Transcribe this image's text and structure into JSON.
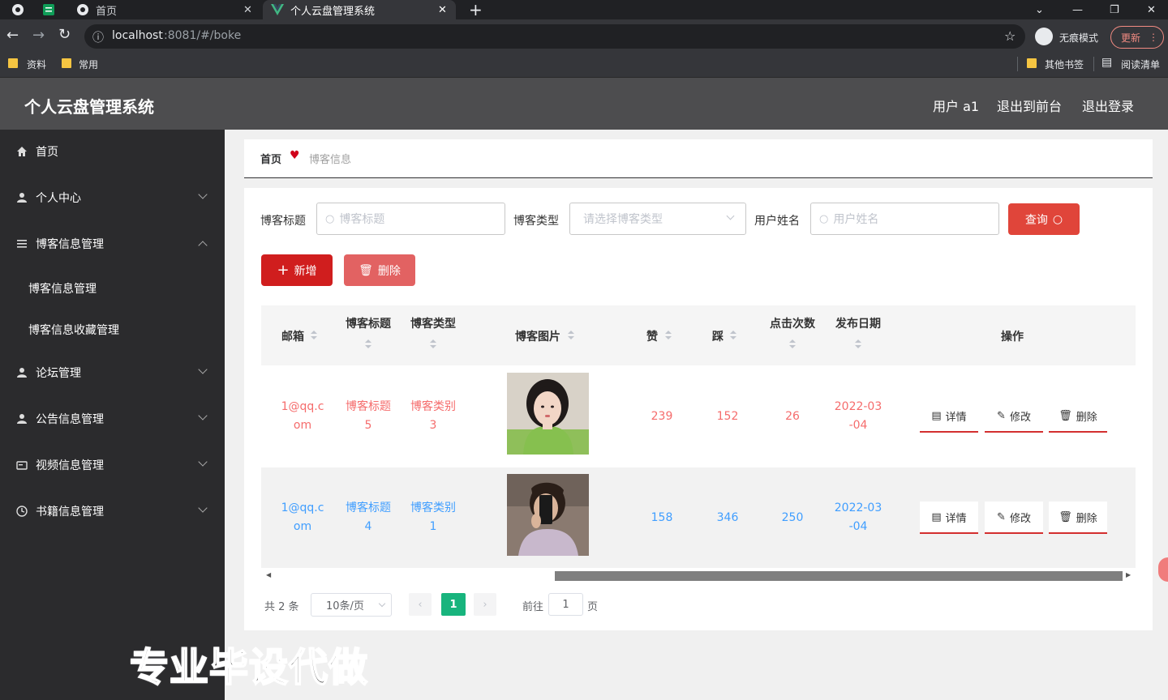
{
  "browser": {
    "tabs": [
      {
        "title": "首页"
      },
      {
        "title": "个人云盘管理系统"
      }
    ],
    "url_host": "localhost",
    "url_rest": ":8081/#/boke",
    "incognito_label": "无痕模式",
    "update_label": "更新",
    "bookmarks": [
      "资料",
      "常用"
    ],
    "other_bookmarks": "其他书签",
    "reading_list": "阅读清单"
  },
  "header": {
    "title": "个人云盘管理系统",
    "user": "用户 a1",
    "back_to_front": "退出到前台",
    "logout": "退出登录"
  },
  "sidebar": {
    "items": [
      {
        "label": "首页"
      },
      {
        "label": "个人中心"
      },
      {
        "label": "博客信息管理"
      },
      {
        "label": "论坛管理"
      },
      {
        "label": "公告信息管理"
      },
      {
        "label": "视频信息管理"
      },
      {
        "label": "书籍信息管理"
      }
    ],
    "sub_items": [
      "博客信息管理",
      "博客信息收藏管理"
    ]
  },
  "breadcrumb": {
    "home": "首页",
    "current": "博客信息"
  },
  "search": {
    "title_label": "博客标题",
    "title_placeholder": "博客标题",
    "type_label": "博客类型",
    "type_placeholder": "请选择博客类型",
    "user_label": "用户姓名",
    "user_placeholder": "用户姓名",
    "query_button": "查询"
  },
  "toolbar": {
    "add": "新增",
    "delete": "删除"
  },
  "table": {
    "columns": {
      "email": "邮箱",
      "title": "博客标题",
      "type": "博客类型",
      "image": "博客图片",
      "like": "赞",
      "dislike": "踩",
      "clicks": "点击次数",
      "date": "发布日期",
      "ops": "操作"
    },
    "rows": [
      {
        "email1": "1@qq.c",
        "email2": "om",
        "title1": "博客标题",
        "title2": "5",
        "type1": "博客类别",
        "type2": "3",
        "like": "239",
        "dislike": "152",
        "clicks": "26",
        "date1": "2022-03",
        "date2": "-04"
      },
      {
        "email1": "1@qq.c",
        "email2": "om",
        "title1": "博客标题",
        "title2": "4",
        "type1": "博客类别",
        "type2": "1",
        "like": "158",
        "dislike": "346",
        "clicks": "250",
        "date1": "2022-03",
        "date2": "-04"
      }
    ],
    "ops": {
      "detail": "详情",
      "edit": "修改",
      "delete": "删除"
    },
    "row_colors": [
      "#f56c6c",
      "#409eff"
    ]
  },
  "pagination": {
    "total": "共 2 条",
    "page_size": "10条/页",
    "current": "1",
    "goto": "前往",
    "goto_value": "1",
    "page_unit": "页"
  },
  "watermark": "专业毕设代做"
}
